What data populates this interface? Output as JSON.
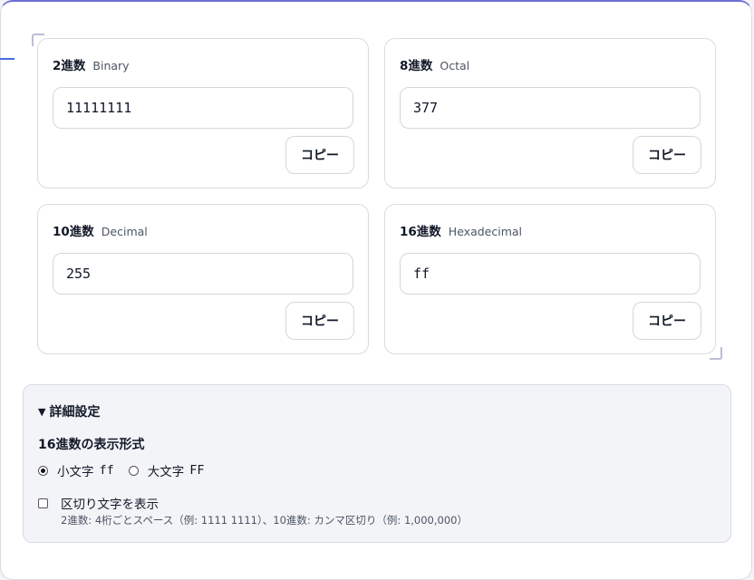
{
  "cards": [
    {
      "name": "2進数",
      "sub": "Binary",
      "value": "11111111",
      "copy_label": "コピー"
    },
    {
      "name": "8進数",
      "sub": "Octal",
      "value": "377",
      "copy_label": "コピー"
    },
    {
      "name": "10進数",
      "sub": "Decimal",
      "value": "255",
      "copy_label": "コピー"
    },
    {
      "name": "16進数",
      "sub": "Hexadecimal",
      "value": "ff",
      "copy_label": "コピー"
    }
  ],
  "settings": {
    "summary_caret": "▼",
    "summary_label": "詳細設定",
    "hex_format_title": "16進数の表示形式",
    "radio_lower_label": "小文字",
    "radio_lower_sample": "ff",
    "radio_upper_label": "大文字",
    "radio_upper_sample": "FF",
    "selected_format": "lower",
    "separator_label": "区切り文字を表示",
    "separator_checked": false,
    "separator_hint": "2進数: 4桁ごとスペース（例: 1111 1111）、10進数: カンマ区切り（例: 1,000,000）"
  },
  "colors": {
    "accent": "#6f6fd8",
    "edge_accent": "#4a6ee0",
    "card_border": "#d9dbe3",
    "settings_bg": "#f3f4f8"
  }
}
